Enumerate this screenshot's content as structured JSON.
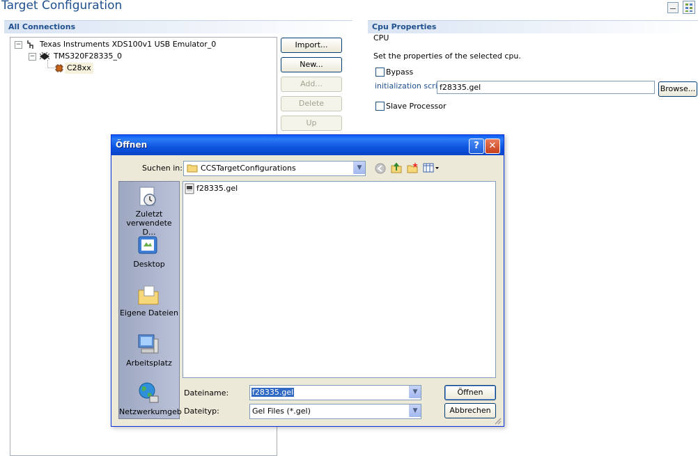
{
  "page": {
    "title": "Target Configuration"
  },
  "connections": {
    "header": "All Connections",
    "tree": [
      {
        "label": "Texas Instruments XDS100v1 USB Emulator_0",
        "icon": "connector-icon",
        "expander": "−"
      },
      {
        "label": "TMS320F28335_0",
        "icon": "chip-icon",
        "expander": "−"
      },
      {
        "label": "C28xx",
        "icon": "cpu-core-icon"
      }
    ],
    "buttons": {
      "import": "Import...",
      "new": "New...",
      "add": "Add...",
      "delete": "Delete",
      "up": "Up"
    }
  },
  "cpu_properties": {
    "header": "Cpu Properties",
    "subtitle": "CPU",
    "description": "Set the properties of the selected cpu.",
    "bypass_label": "Bypass",
    "bypass_checked": false,
    "init_script_label": "initialization script",
    "init_script_value": "f28335.gel",
    "browse_label": "Browse...",
    "slave_label": "Slave Processor",
    "slave_checked": false
  },
  "dialog": {
    "title": "Öffnen",
    "help_glyph": "?",
    "close_glyph": "✕",
    "look_in_label": "Suchen in:",
    "look_in_value": "CCSTargetConfigurations",
    "places": [
      {
        "label": "Zuletzt verwendete D...",
        "icon": "recent-documents-icon"
      },
      {
        "label": "Desktop",
        "icon": "desktop-icon"
      },
      {
        "label": "Eigene Dateien",
        "icon": "my-documents-icon"
      },
      {
        "label": "Arbeitsplatz",
        "icon": "my-computer-icon"
      },
      {
        "label": "Netzwerkumgeb",
        "icon": "network-icon"
      }
    ],
    "files": [
      {
        "name": "f28335.gel",
        "icon": "gel-file-icon"
      }
    ],
    "filename_label": "Dateiname:",
    "filename_value": "f28335.gel",
    "filetype_label": "Dateityp:",
    "filetype_value": "Gel Files (*.gel)",
    "open_button": "Öffnen",
    "cancel_button": "Abbrechen"
  },
  "colors": {
    "accent": "#1f4f8f",
    "dialog_title_bar": "#0a5bf5",
    "dialog_face": "#ece9d8"
  }
}
